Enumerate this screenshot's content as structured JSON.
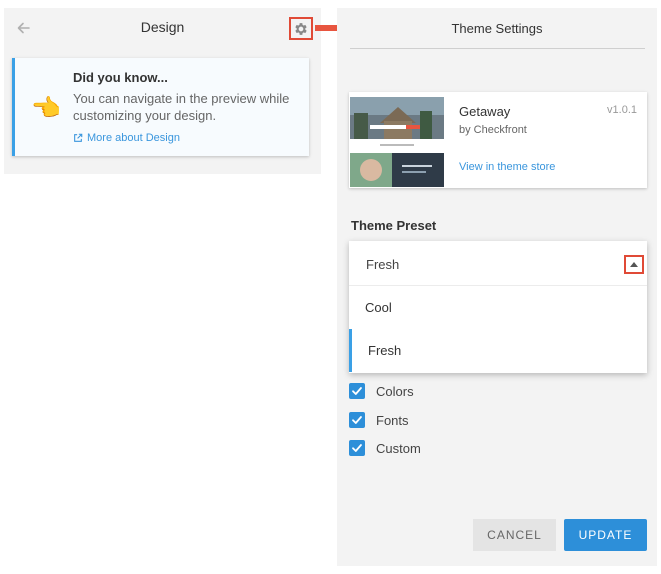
{
  "design_panel": {
    "title": "Design",
    "back_icon": "arrow-left-icon",
    "settings_icon": "gear-icon",
    "tip": {
      "title": "Did you know...",
      "body": "You can navigate in the preview while customizing your design.",
      "link_label": "More about Design",
      "hand_emoji": "👈"
    }
  },
  "theme_settings": {
    "title": "Theme Settings",
    "theme": {
      "name": "Getaway",
      "author": "by Checkfront",
      "version": "v1.0.1",
      "store_link": "View in theme store"
    },
    "preset": {
      "label": "Theme Preset",
      "selected": "Fresh",
      "options": [
        "Cool",
        "Fresh"
      ]
    },
    "checkboxes": [
      {
        "label": "Colors",
        "checked": true
      },
      {
        "label": "Fonts",
        "checked": true
      },
      {
        "label": "Custom",
        "checked": true
      }
    ],
    "buttons": {
      "cancel": "CANCEL",
      "update": "UPDATE"
    }
  },
  "colors": {
    "accent": "#2d8fd9",
    "highlight": "#e04a36",
    "panel": "#f3f3f3"
  }
}
